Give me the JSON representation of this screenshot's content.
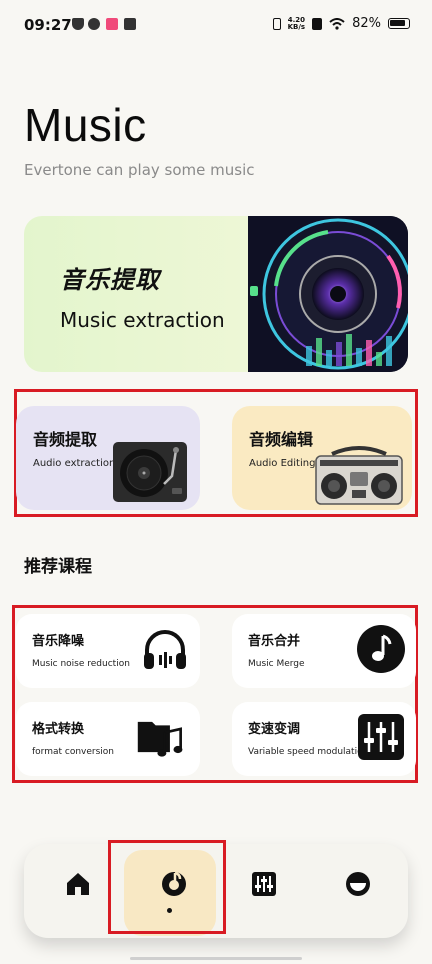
{
  "status_bar": {
    "time": "09:27",
    "net_speed_value": "4.20",
    "net_speed_unit": "KB/s",
    "battery": "82%"
  },
  "header": {
    "title": "Music",
    "subtitle": "Evertone can play some music"
  },
  "hero": {
    "title_cn": "音乐提取",
    "title_en": "Music extraction"
  },
  "features": [
    {
      "label_cn": "音频提取",
      "label_en": "Audio extraction",
      "color": "#e6e3f3",
      "icon": "turntable-icon"
    },
    {
      "label_cn": "音频编辑",
      "label_en": "Audio Editing",
      "color": "#faeac2",
      "icon": "boombox-icon"
    }
  ],
  "courses_section": {
    "title": "推荐课程",
    "items": [
      {
        "label_cn": "音乐降噪",
        "label_en": "Music noise reduction",
        "icon": "headphones-icon"
      },
      {
        "label_cn": "音乐合并",
        "label_en": "Music Merge",
        "icon": "music-note-icon"
      },
      {
        "label_cn": "格式转换",
        "label_en": "format conversion",
        "icon": "folder-music-icon"
      },
      {
        "label_cn": "变速变调",
        "label_en": "Variable speed modulation",
        "icon": "equalizer-icon"
      }
    ]
  },
  "bottom_nav": {
    "items": [
      {
        "icon": "home-icon",
        "active": false
      },
      {
        "icon": "music-disc-icon",
        "active": true
      },
      {
        "icon": "mixer-icon",
        "active": false
      },
      {
        "icon": "profile-icon",
        "active": false
      }
    ]
  },
  "colors": {
    "background": "#f8f7f3",
    "hero_bg": "#e3f5cd",
    "annotation_red": "#d81b23",
    "active_nav": "#f8e8c4"
  }
}
